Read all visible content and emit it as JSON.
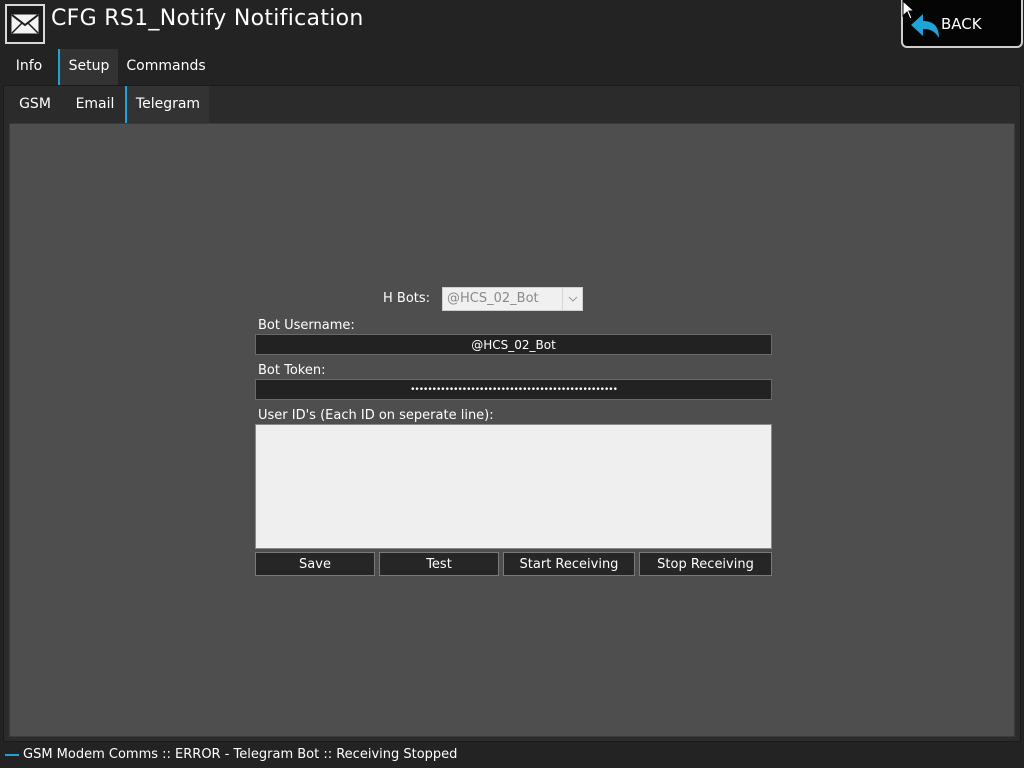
{
  "window": {
    "title": "CFG RS1_Notify Notification",
    "back_label": "BACK",
    "icon": "envelope-icon"
  },
  "tabs_primary": [
    {
      "label": "Info",
      "active": false
    },
    {
      "label": "Setup",
      "active": true
    },
    {
      "label": "Commands",
      "active": false
    }
  ],
  "tabs_secondary": [
    {
      "label": "GSM",
      "active": false
    },
    {
      "label": "Email",
      "active": false
    },
    {
      "label": "Telegram",
      "active": true
    }
  ],
  "telegram": {
    "bots_label": "H Bots:",
    "bots_selected": "@HCS_02_Bot",
    "username_label": "Bot Username:",
    "username_value": "@HCS_02_Bot",
    "token_label": "Bot Token:",
    "token_value": "••••••••••••••••••••••••••••••••••••••••••••••••",
    "userids_label": "User ID's (Each ID on seperate line):",
    "userids_value": "",
    "buttons": {
      "save": "Save",
      "test": "Test",
      "start": "Start Receiving",
      "stop": "Stop Receiving"
    }
  },
  "status": {
    "text": "GSM Modem Comms :: ERROR - Telegram Bot :: Receiving Stopped"
  },
  "colors": {
    "accent": "#1fa2d6",
    "background": "#232323",
    "panel": "#4e4e4e"
  }
}
